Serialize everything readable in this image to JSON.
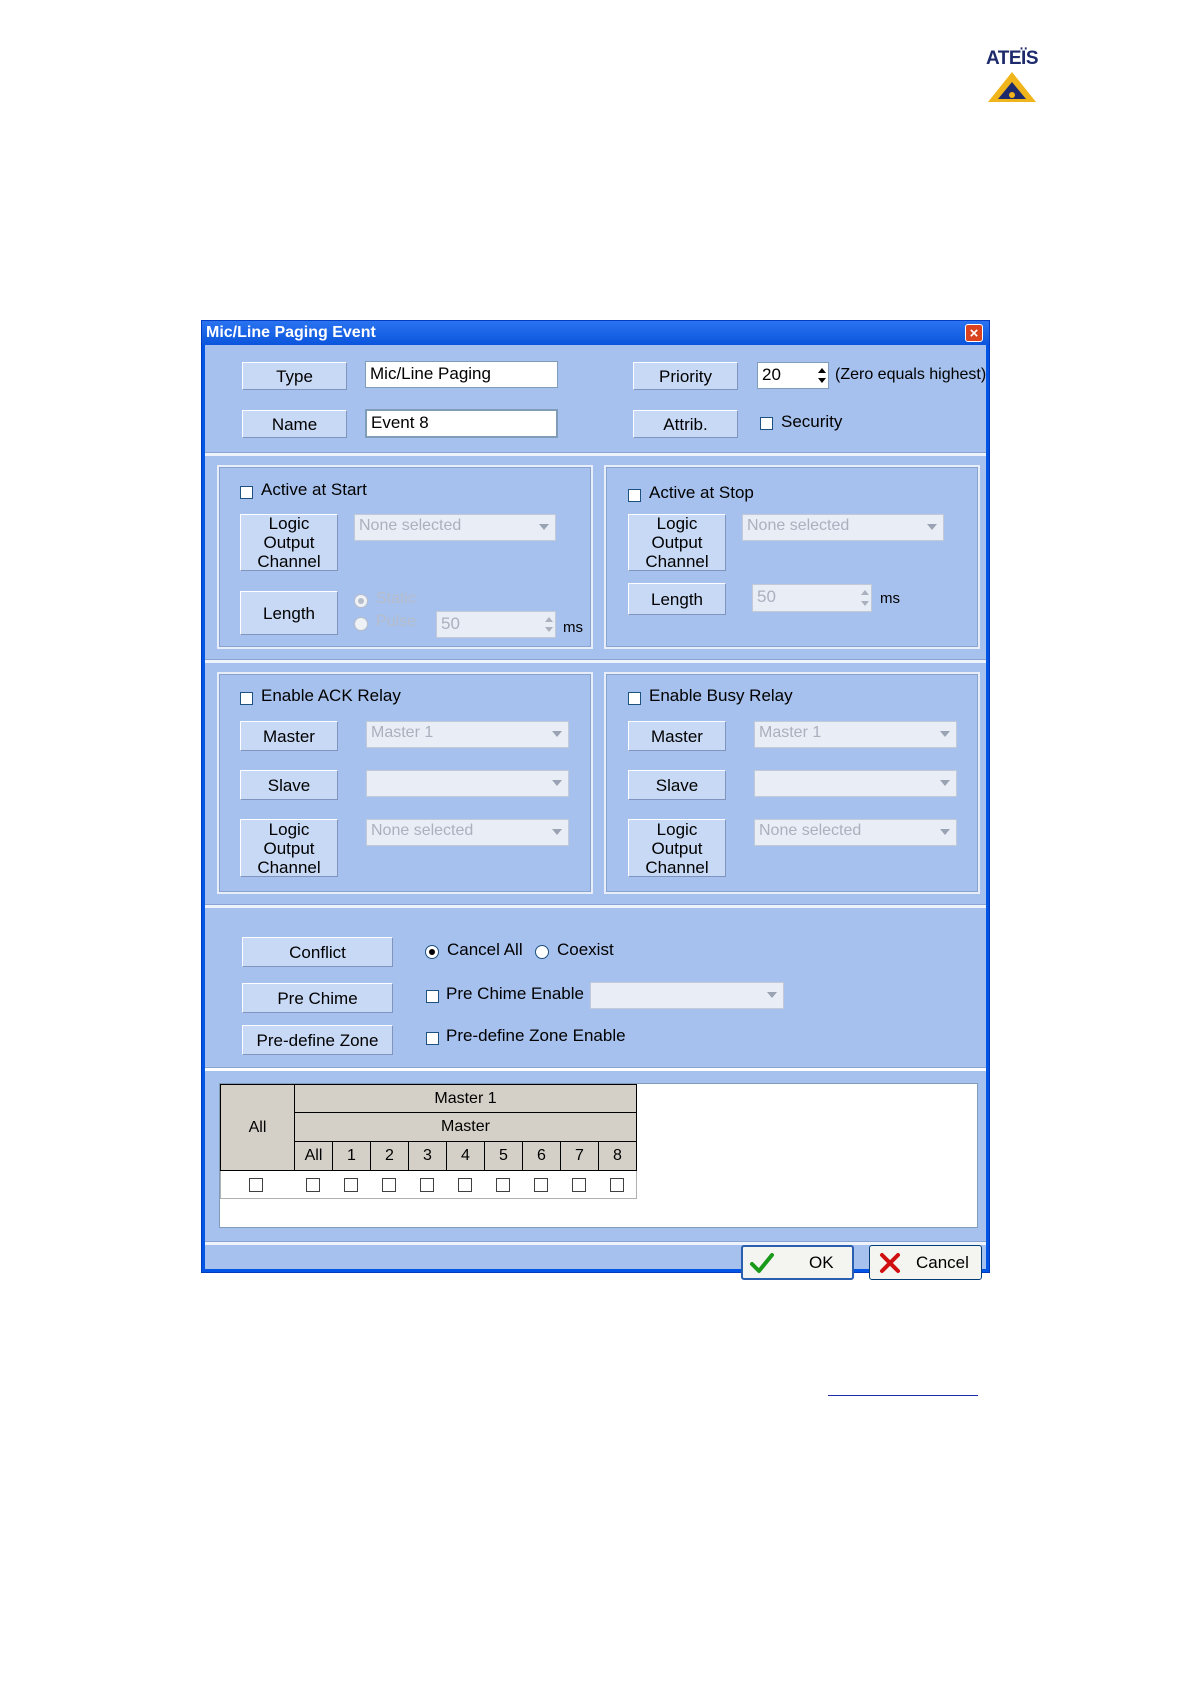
{
  "logo": {
    "text": "ATEÏS"
  },
  "dialog": {
    "title": "Mic/Line Paging Event",
    "close": "×"
  },
  "header": {
    "type_label": "Type",
    "type_value": "Mic/Line Paging",
    "name_label": "Name",
    "name_value": "Event 8",
    "priority_label": "Priority",
    "priority_value": "20",
    "priority_note": "(Zero equals highest)",
    "attrib_label": "Attrib.",
    "security_label": "Security"
  },
  "active_start": {
    "checkbox_label": "Active at Start",
    "logic_label": "Logic Output Channel",
    "logic_value": "None selected",
    "length_label": "Length",
    "static_label": "Static",
    "pulse_label": "Pulse",
    "pulse_value": "50",
    "unit": "ms"
  },
  "active_stop": {
    "checkbox_label": "Active at Stop",
    "logic_label": "Logic Output Channel",
    "logic_value": "None selected",
    "length_label": "Length",
    "length_value": "50",
    "unit": "ms"
  },
  "ack_relay": {
    "checkbox_label": "Enable ACK Relay",
    "master_label": "Master",
    "master_value": "Master 1",
    "slave_label": "Slave",
    "slave_value": "",
    "logic_label": "Logic Output Channel",
    "logic_value": "None selected"
  },
  "busy_relay": {
    "checkbox_label": "Enable Busy Relay",
    "master_label": "Master",
    "master_value": "Master 1",
    "slave_label": "Slave",
    "slave_value": "",
    "logic_label": "Logic Output Channel",
    "logic_value": "None selected"
  },
  "options": {
    "conflict_label": "Conflict",
    "cancel_all_label": "Cancel All",
    "coexist_label": "Coexist",
    "prechime_label": "Pre Chime",
    "prechime_enable_label": "Pre Chime Enable",
    "predefine_label": "Pre-define Zone",
    "predefine_enable_label": "Pre-define Zone Enable"
  },
  "zones": {
    "all_label": "All",
    "master_name": "Master 1",
    "group_label": "Master",
    "columns": [
      "All",
      "1",
      "2",
      "3",
      "4",
      "5",
      "6",
      "7",
      "8"
    ]
  },
  "footer": {
    "ok_label": "OK",
    "cancel_label": "Cancel"
  },
  "colors": {
    "title_bar": "#0a55dc",
    "client_bg": "#a6c1ed",
    "ok_check": "#1a9a1a",
    "cancel_x": "#d01010"
  }
}
